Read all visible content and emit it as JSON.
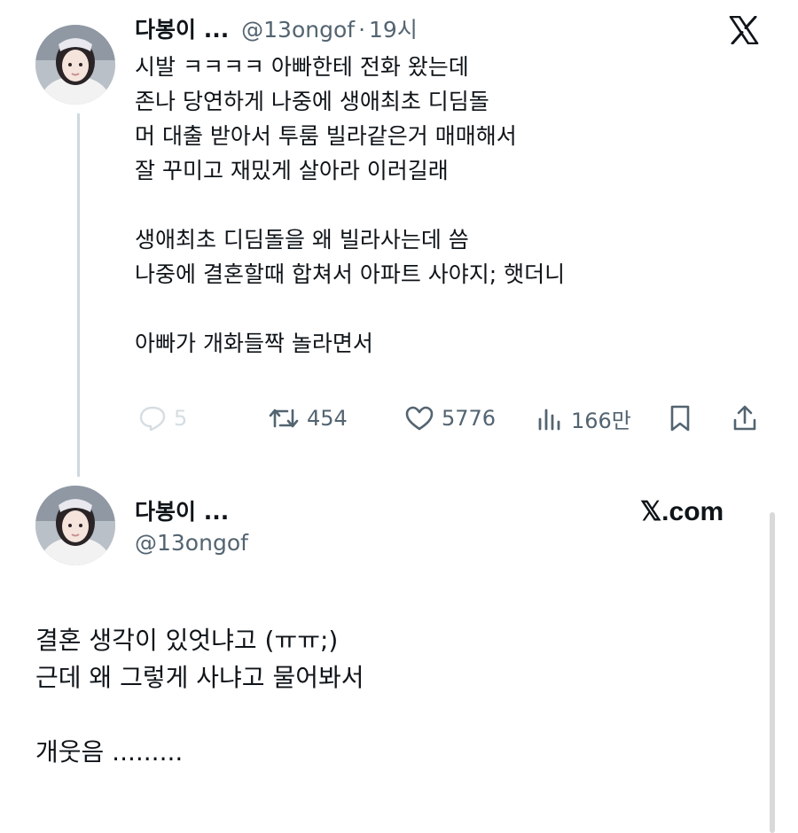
{
  "tweet": {
    "author_name": "다봉이 ...",
    "handle": "@13ongof",
    "separator": "·",
    "time": "19시",
    "lines": [
      "시발 ㅋㅋㅋㅋ 아빠한테 전화 왔는데",
      "존나 당연하게 나중에 생애최초 디딤돌",
      "머 대출 받아서 투룸 빌라같은거 매매해서",
      "잘 꾸미고 재밌게 살아라 이러길래",
      "",
      "생애최초 디딤돌을 왜 빌라사는데 씀",
      "나중에 결혼할때 합쳐서 아파트 사야지; 햇더니",
      "",
      "아빠가 개화들짝 놀라면서"
    ],
    "actions": {
      "replies": "5",
      "retweets": "454",
      "likes": "5776",
      "views": "166만"
    },
    "icons": {
      "reply": "reply-icon",
      "retweet": "retweet-icon",
      "like": "heart-icon",
      "views": "views-icon",
      "bookmark": "bookmark-icon",
      "share": "share-icon",
      "brand": "x-logo-icon"
    }
  },
  "card": {
    "author_name": "다봉이 ...",
    "handle": "@13ongof",
    "brand_label": "𝕏.com",
    "lines": [
      "결혼 생각이 있엇냐고 (ㅠㅠ;)",
      "근데 왜 그렇게 사냐고 물어봐서",
      "",
      "개웃음 ........."
    ]
  },
  "colors": {
    "text": "#0f1419",
    "muted": "#536471",
    "thread_line": "#cfd9de",
    "background": "#ffffff"
  }
}
